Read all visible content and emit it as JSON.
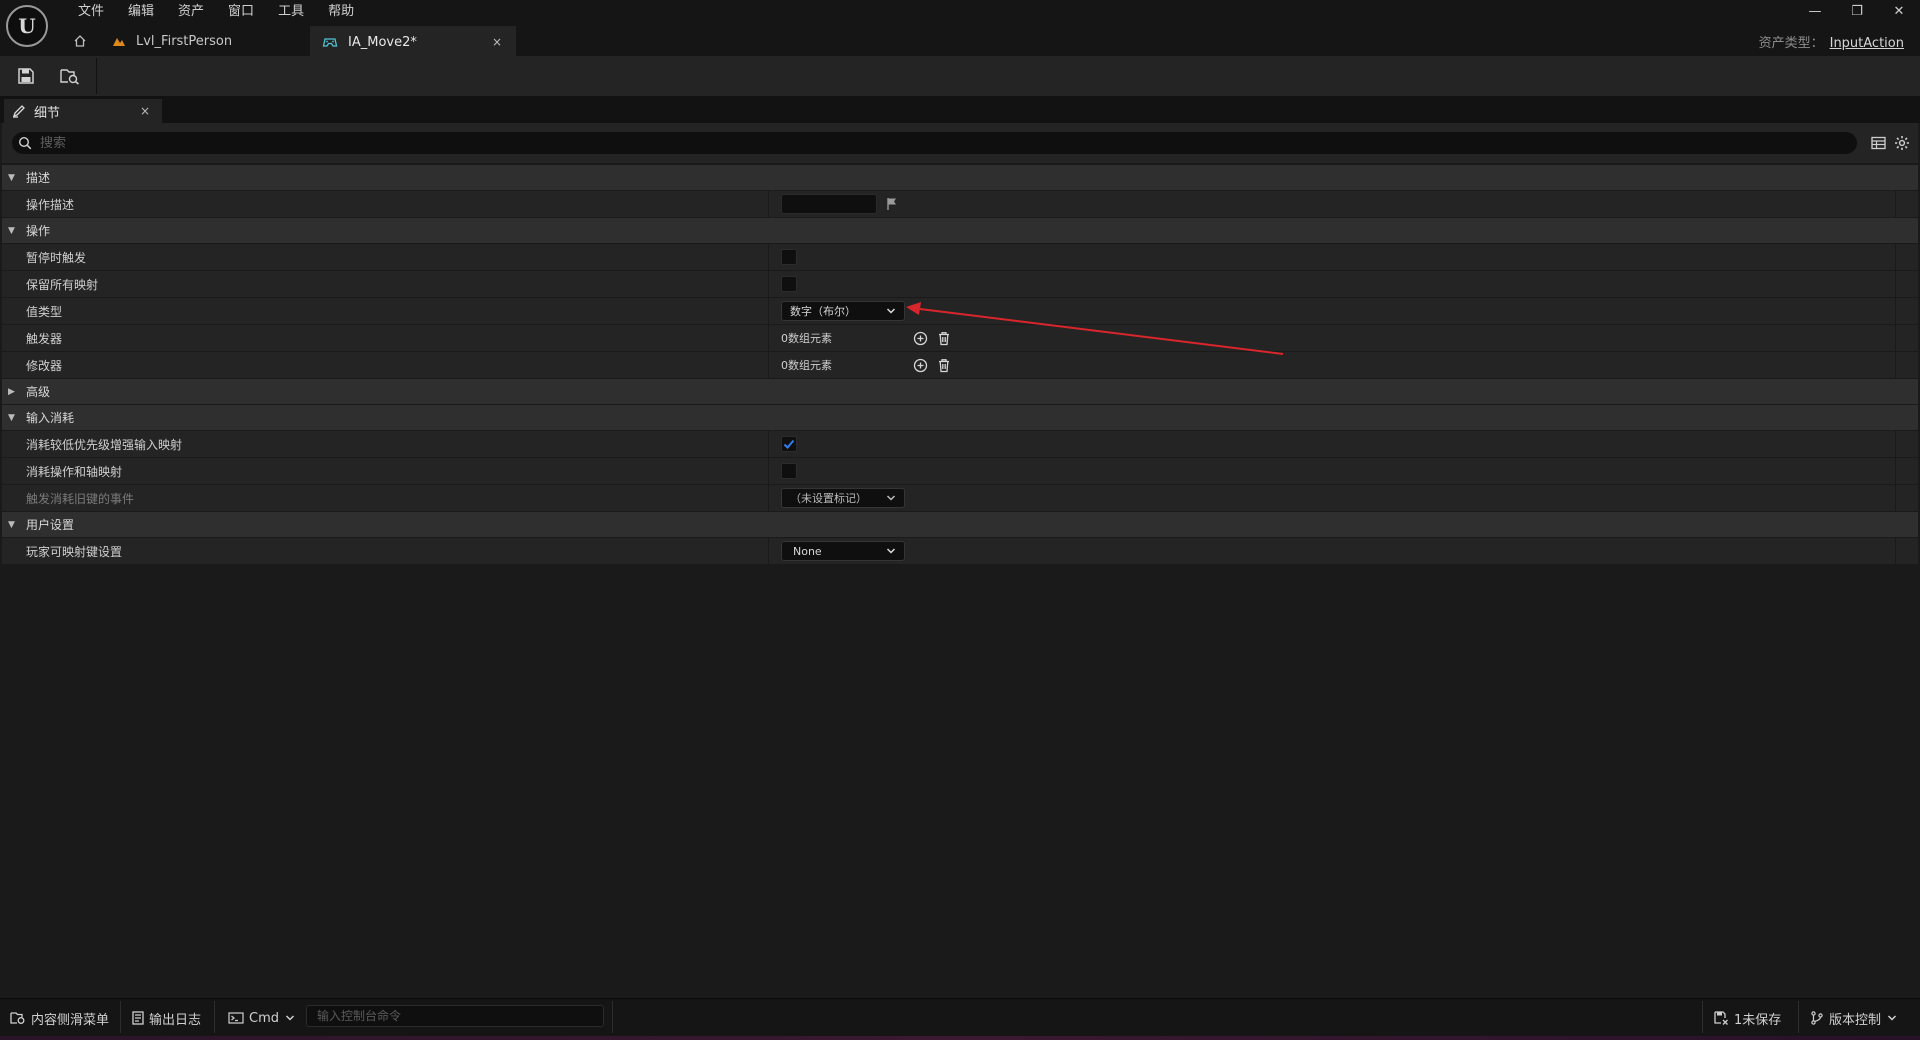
{
  "menu": [
    "文件",
    "编辑",
    "资产",
    "窗口",
    "工具",
    "帮助"
  ],
  "tabs": {
    "level": {
      "label": "Lvl_FirstPerson"
    },
    "asset": {
      "label": "IA_Move2*",
      "close": "×"
    }
  },
  "window_controls": {
    "minimize": "—",
    "restore": "❐",
    "close": "✕"
  },
  "asset_type": {
    "label": "资产类型：",
    "value": "InputAction"
  },
  "panel": {
    "title": "细节",
    "close": "×"
  },
  "search": {
    "placeholder": "搜索"
  },
  "sections": {
    "description": {
      "label": "描述",
      "action_description": {
        "label": "操作描述",
        "value": ""
      }
    },
    "action": {
      "label": "操作",
      "trigger_when_paused": {
        "label": "暂停时触发",
        "checked": false
      },
      "reserve_all_mappings": {
        "label": "保留所有映射",
        "checked": false
      },
      "value_type": {
        "label": "值类型",
        "value": "数字（布尔）"
      },
      "triggers": {
        "label": "触发器",
        "value": "0数组元素"
      },
      "modifiers": {
        "label": "修改器",
        "value": "0数组元素"
      }
    },
    "advanced": {
      "label": "高级"
    },
    "input_consumption": {
      "label": "输入消耗",
      "consume_lower_priority": {
        "label": "消耗较低优先级增强输入映射",
        "checked": true
      },
      "consume_action_axis": {
        "label": "消耗操作和轴映射",
        "checked": false
      },
      "trigger_consumed_events": {
        "label": "触发消耗旧键的事件",
        "value": "（未设置标记）"
      }
    },
    "user_settings": {
      "label": "用户设置",
      "player_mappable_key_settings": {
        "label": "玩家可映射键设置",
        "value": "None"
      }
    }
  },
  "statusbar": {
    "content_drawer": "内容侧滑菜单",
    "output_log": "输出日志",
    "cmd": "Cmd",
    "console_placeholder": "输入控制台命令",
    "unsaved": "1未保存",
    "source_control": "版本控制"
  },
  "colors": {
    "annotation_arrow": "#d9262c",
    "checkbox_accent": "#2f80ed"
  }
}
